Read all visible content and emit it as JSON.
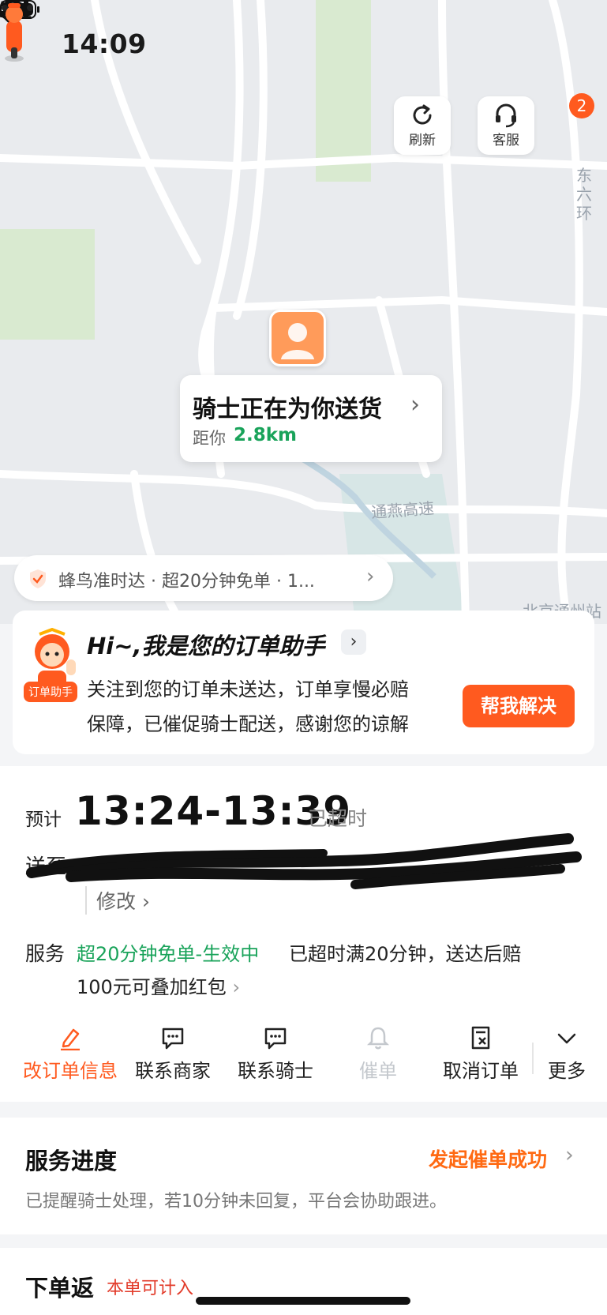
{
  "status_bar": {
    "time": "14:09"
  },
  "header": {
    "refresh_label": "刷新",
    "service_label": "客服",
    "more_badge": "2"
  },
  "map": {
    "road_labels": [
      "东六环",
      "通燕高速",
      "北京通州站"
    ],
    "rider_bubble": {
      "title": "骑士正在为你送货",
      "distance_prefix": "距你",
      "distance": "2.8km"
    },
    "guarantee_pill": "蜂鸟准时达 · 超20分钟免单 · 1..."
  },
  "assistant": {
    "tag": "订单助手",
    "title": "Hi~,我是您的订单助手",
    "line1": "关注到您的订单未送达，订单享慢必赔",
    "line2": "保障，已催促骑士配送，感谢您的谅解",
    "button": "帮我解决"
  },
  "order": {
    "eta_label": "预计",
    "eta_time": "13:24-13:39",
    "eta_status": "已超时",
    "address_prefix": "送至",
    "modify": "修改",
    "service_label": "服务",
    "service_highlight": "超20分钟免单-生效中",
    "service_text_1": "已超时满20分钟，送达后赔",
    "service_text_2": "100元可叠加红包",
    "actions": [
      {
        "label": "改订单信息",
        "icon": "edit-icon"
      },
      {
        "label": "联系商家",
        "icon": "chat-icon"
      },
      {
        "label": "联系骑士",
        "icon": "chat-icon"
      },
      {
        "label": "催单",
        "icon": "bell-icon"
      },
      {
        "label": "取消订单",
        "icon": "cancel-order-icon"
      },
      {
        "label": "更多",
        "icon": "chevron-down-icon"
      }
    ]
  },
  "progress": {
    "title": "服务进度",
    "status": "发起催单成功",
    "description": "已提醒骑士处理，若10分钟未回复，平台会协助跟进。"
  },
  "rebate": {
    "title": "下单返",
    "note": "本单可计入"
  },
  "colors": {
    "accent": "#ff5a1f",
    "green": "#19a35a",
    "orange_text": "#ff6a13"
  }
}
